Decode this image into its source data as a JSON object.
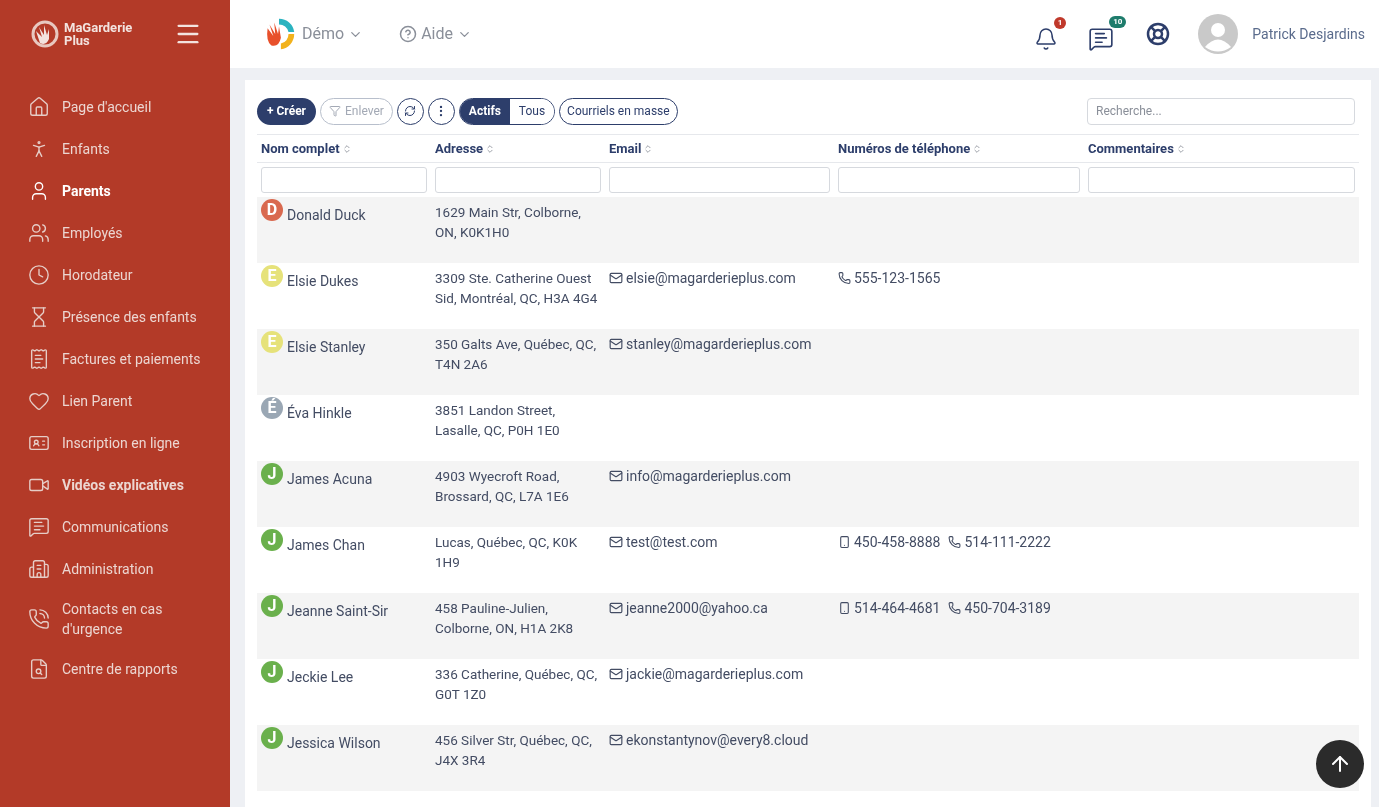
{
  "brand": {
    "name": "MaGarderie Plus"
  },
  "sidebar": {
    "items": [
      {
        "label": "Page d'accueil",
        "selected": false,
        "emphasized": false
      },
      {
        "label": "Enfants",
        "selected": false,
        "emphasized": false
      },
      {
        "label": "Parents",
        "selected": true,
        "emphasized": false
      },
      {
        "label": "Employés",
        "selected": false,
        "emphasized": false
      },
      {
        "label": "Horodateur",
        "selected": false,
        "emphasized": false
      },
      {
        "label": "Présence des enfants",
        "selected": false,
        "emphasized": false
      },
      {
        "label": "Factures et paiements",
        "selected": false,
        "emphasized": false
      },
      {
        "label": "Lien Parent",
        "selected": false,
        "emphasized": false
      },
      {
        "label": "Inscription en ligne",
        "selected": false,
        "emphasized": false
      },
      {
        "label": "Vidéos explicatives",
        "selected": false,
        "emphasized": true
      },
      {
        "label": "Communications",
        "selected": false,
        "emphasized": false
      },
      {
        "label": "Administration",
        "selected": false,
        "emphasized": false
      },
      {
        "label": "Contacts en cas d'urgence",
        "selected": false,
        "emphasized": false
      },
      {
        "label": "Centre de rapports",
        "selected": false,
        "emphasized": false
      }
    ]
  },
  "header": {
    "menus": [
      {
        "label": "Démo",
        "kind": "org"
      },
      {
        "label": "Aide",
        "kind": "help"
      }
    ],
    "notifications": {
      "count": "1"
    },
    "messages": {
      "count": "10"
    },
    "user": {
      "name": "Patrick Desjardins"
    }
  },
  "toolbar": {
    "create": "+ Créer",
    "remove": "Enlever",
    "filter_tabs": [
      {
        "label": "Actifs",
        "selected": true
      },
      {
        "label": "Tous",
        "selected": false
      }
    ],
    "bulk_email": "Courriels en masse",
    "search": {
      "placeholder": "Recherche..."
    }
  },
  "table": {
    "columns": [
      "Nom complet",
      "Adresse",
      "Email",
      "Numéros de téléphone",
      "Commentaires"
    ],
    "rows": [
      {
        "initial": "D",
        "color": "#d9694f",
        "name": "Donald Duck",
        "address": "1629 Main Str, Colborne, ON, K0K1H0",
        "phones": []
      },
      {
        "initial": "E",
        "color": "#e6e27a",
        "name": "Elsie Dukes",
        "address": "3309 Ste. Catherine Ouest Sid, Montréal, QC, H3A 4G4",
        "email": "elsie@magarderieplus.com",
        "phones": [
          {
            "kind": "phone",
            "number": "555-123-1565"
          }
        ]
      },
      {
        "initial": "E",
        "color": "#e6e27a",
        "name": "Elsie Stanley",
        "address": "350 Galts Ave, Québec, QC, T4N 2A6",
        "email": "stanley@magarderieplus.com",
        "phones": []
      },
      {
        "initial": "É",
        "color": "#9aa7b4",
        "name": "Éva Hinkle",
        "address": "3851 Landon Street, Lasalle, QC, P0H 1E0",
        "phones": []
      },
      {
        "initial": "J",
        "color": "#6ab04c",
        "name": "James Acuna",
        "address": "4903 Wyecroft Road, Brossard, QC, L7A 1E6",
        "email": "info@magarderieplus.com",
        "phones": []
      },
      {
        "initial": "J",
        "color": "#6ab04c",
        "name": "James Chan",
        "address": "Lucas, Québec, QC, K0K 1H9",
        "email": "test@test.com",
        "phones": [
          {
            "kind": "mobile",
            "number": "450-458-8888"
          },
          {
            "kind": "phone",
            "number": "514-111-2222"
          }
        ]
      },
      {
        "initial": "J",
        "color": "#6ab04c",
        "name": "Jeanne Saint-Sir",
        "address": "458 Pauline-Julien, Colborne, ON, H1A 2K8",
        "email": "jeanne2000@yahoo.ca",
        "phones": [
          {
            "kind": "mobile",
            "number": "514-464-4681"
          },
          {
            "kind": "phone",
            "number": "450-704-3189"
          }
        ]
      },
      {
        "initial": "J",
        "color": "#6ab04c",
        "name": "Jeckie Lee",
        "address": "336 Catherine, Québec, QC, G0T 1Z0",
        "email": "jackie@magarderieplus.com",
        "phones": []
      },
      {
        "initial": "J",
        "color": "#6ab04c",
        "name": "Jessica Wilson",
        "address": "456 Silver Str, Québec, QC, J4X 3R4",
        "email": "ekonstantynov@every8.cloud",
        "phones": []
      }
    ]
  }
}
